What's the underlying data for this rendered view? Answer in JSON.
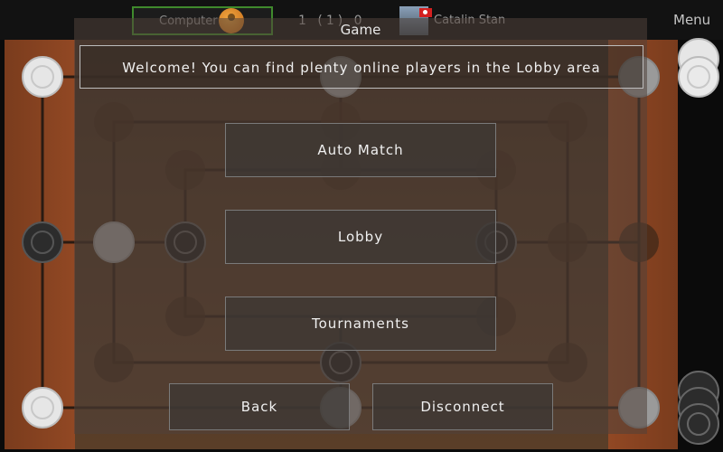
{
  "header": {
    "player_left_name": "Computer",
    "score": "1 (1) 0",
    "player_right_name": "Catalin Stan",
    "menu_label": "Menu"
  },
  "dialog": {
    "title": "Game",
    "welcome": "Welcome! You can find plenty online players in the Lobby area",
    "auto_match_label": "Auto Match",
    "lobby_label": "Lobby",
    "tournaments_label": "Tournaments",
    "back_label": "Back",
    "disconnect_label": "Disconnect"
  },
  "colors": {
    "accent_border": "#3f8a2c",
    "white_piece": "#e8e8e8",
    "black_piece": "#2c2c2c"
  },
  "icons": [
    "computer-avatar-icon",
    "turkey-flag-icon",
    "user-photo-icon"
  ]
}
